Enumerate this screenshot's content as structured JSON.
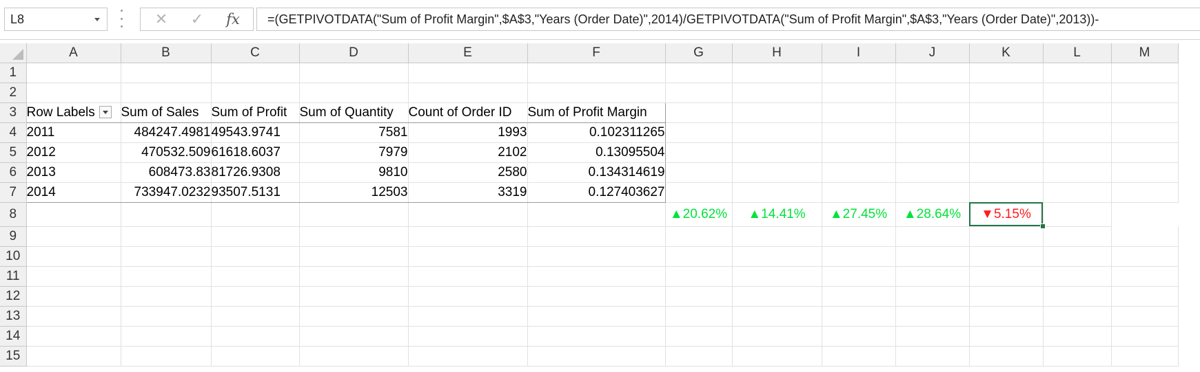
{
  "formula_bar": {
    "name_box": "L8",
    "cancel_icon": "✕",
    "enter_icon": "✓",
    "fx_label": "fx",
    "formula": "=(GETPIVOTDATA(\"Sum of Profit Margin\",$A$3,\"Years (Order Date)\",2014)/GETPIVOTDATA(\"Sum of Profit Margin\",$A$3,\"Years (Order Date)\",2013))-"
  },
  "columns": [
    "A",
    "B",
    "C",
    "D",
    "E",
    "F",
    "G",
    "H",
    "I",
    "J",
    "K",
    "L",
    "M"
  ],
  "selected_column": "L",
  "rows": [
    "1",
    "2",
    "3",
    "4",
    "5",
    "6",
    "7",
    "8",
    "9",
    "10",
    "11",
    "12",
    "13",
    "14",
    "15"
  ],
  "pivot": {
    "headers": [
      "Row Labels",
      "Sum of Sales",
      "Sum of Profit",
      "Sum of Quantity",
      "Count of Order ID",
      "Sum of Profit Margin"
    ],
    "data": [
      [
        "2011",
        "484247.4981",
        "49543.9741",
        "7581",
        "1993",
        "0.102311265"
      ],
      [
        "2012",
        "470532.509",
        "61618.6037",
        "7979",
        "2102",
        "0.13095504"
      ],
      [
        "2013",
        "608473.83",
        "81726.9308",
        "9810",
        "2580",
        "0.134314619"
      ],
      [
        "2014",
        "733947.0232",
        "93507.5131",
        "12503",
        "3319",
        "0.127403627"
      ]
    ]
  },
  "kpis": {
    "H8": "▲20.62%",
    "I8": "▲14.41%",
    "J8": "▲27.45%",
    "K8": "▲28.64%",
    "L8": "▼5.15%"
  },
  "colors": {
    "up": "#00e33a",
    "down": "#ff1c1c",
    "selection": "#217346"
  }
}
